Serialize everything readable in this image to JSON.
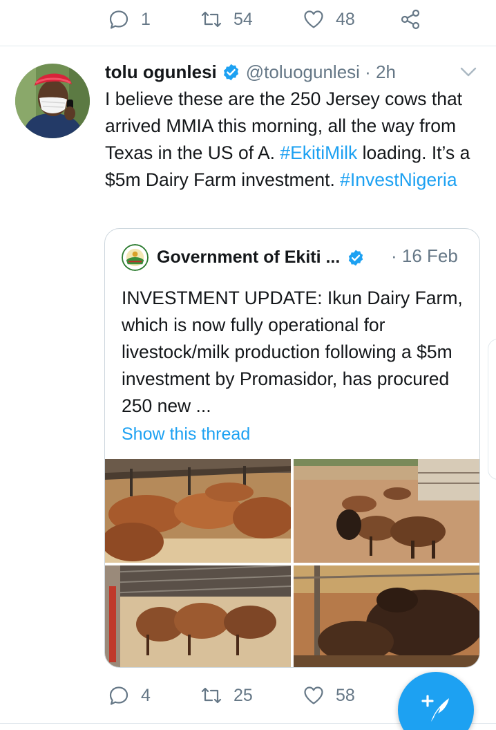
{
  "previous_tweet_actions": {
    "reply_count": "1",
    "retweet_count": "54",
    "like_count": "48"
  },
  "tweet": {
    "author_name": "tolu ogunlesi",
    "handle_time": "@toluogunlesi · 2h",
    "text_part1": "I believe these are the 250 Jersey cows that arrived MMIA this morning, all the way from Texas in the US of A. ",
    "hashtag1": "#EkitiMilk",
    "text_part2": " loading. It’s a $5m Dairy Farm investment. ",
    "hashtag2": "#InvestNigeria",
    "quoted": {
      "author_name": "Government of Ekiti ...",
      "date": "· 16 Feb",
      "text": "INVESTMENT UPDATE: Ikun Dairy Farm, which is now fully operational for livestock/milk production following a $5m investment by Promasidor, has procured 250 new ...",
      "show_thread": "Show this thread"
    },
    "actions": {
      "reply_count": "4",
      "retweet_count": "25",
      "like_count": "58"
    }
  },
  "colors": {
    "accent": "#1da1f2",
    "text": "#14171a",
    "secondary": "#657786",
    "border": "#ccd6dd"
  },
  "icons": [
    "reply-icon",
    "retweet-icon",
    "like-icon",
    "share-icon",
    "verified-badge-icon",
    "chevron-down-icon",
    "compose-tweet-icon"
  ]
}
